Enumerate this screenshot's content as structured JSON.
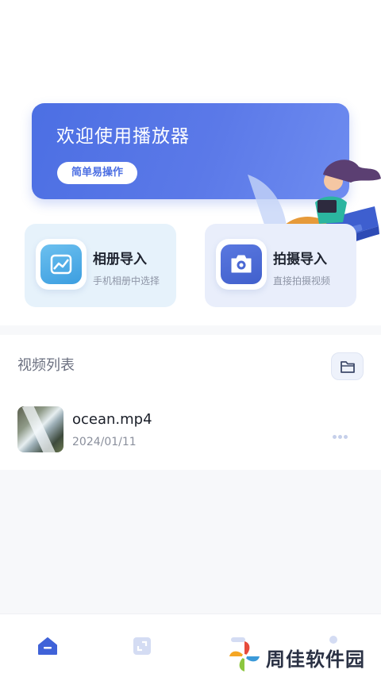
{
  "banner": {
    "title": "欢迎使用播放器",
    "button_label": "简单易操作"
  },
  "cards": [
    {
      "title": "相册导入",
      "subtitle": "手机相册中选择",
      "icon": "gallery-icon"
    },
    {
      "title": "拍摄导入",
      "subtitle": "直接拍摄视频",
      "icon": "camera-icon"
    }
  ],
  "video_list": {
    "title": "视频列表",
    "folder_icon": "folder-icon",
    "items": [
      {
        "name": "ocean.mp4",
        "date": "2024/01/11"
      }
    ]
  },
  "bottom_nav": {
    "items": [
      "home-icon",
      "crop-icon",
      "nav-icon-3",
      "nav-icon-4"
    ],
    "active_color": "#4c6fe3"
  },
  "watermark": {
    "text": "周佳软件园"
  }
}
